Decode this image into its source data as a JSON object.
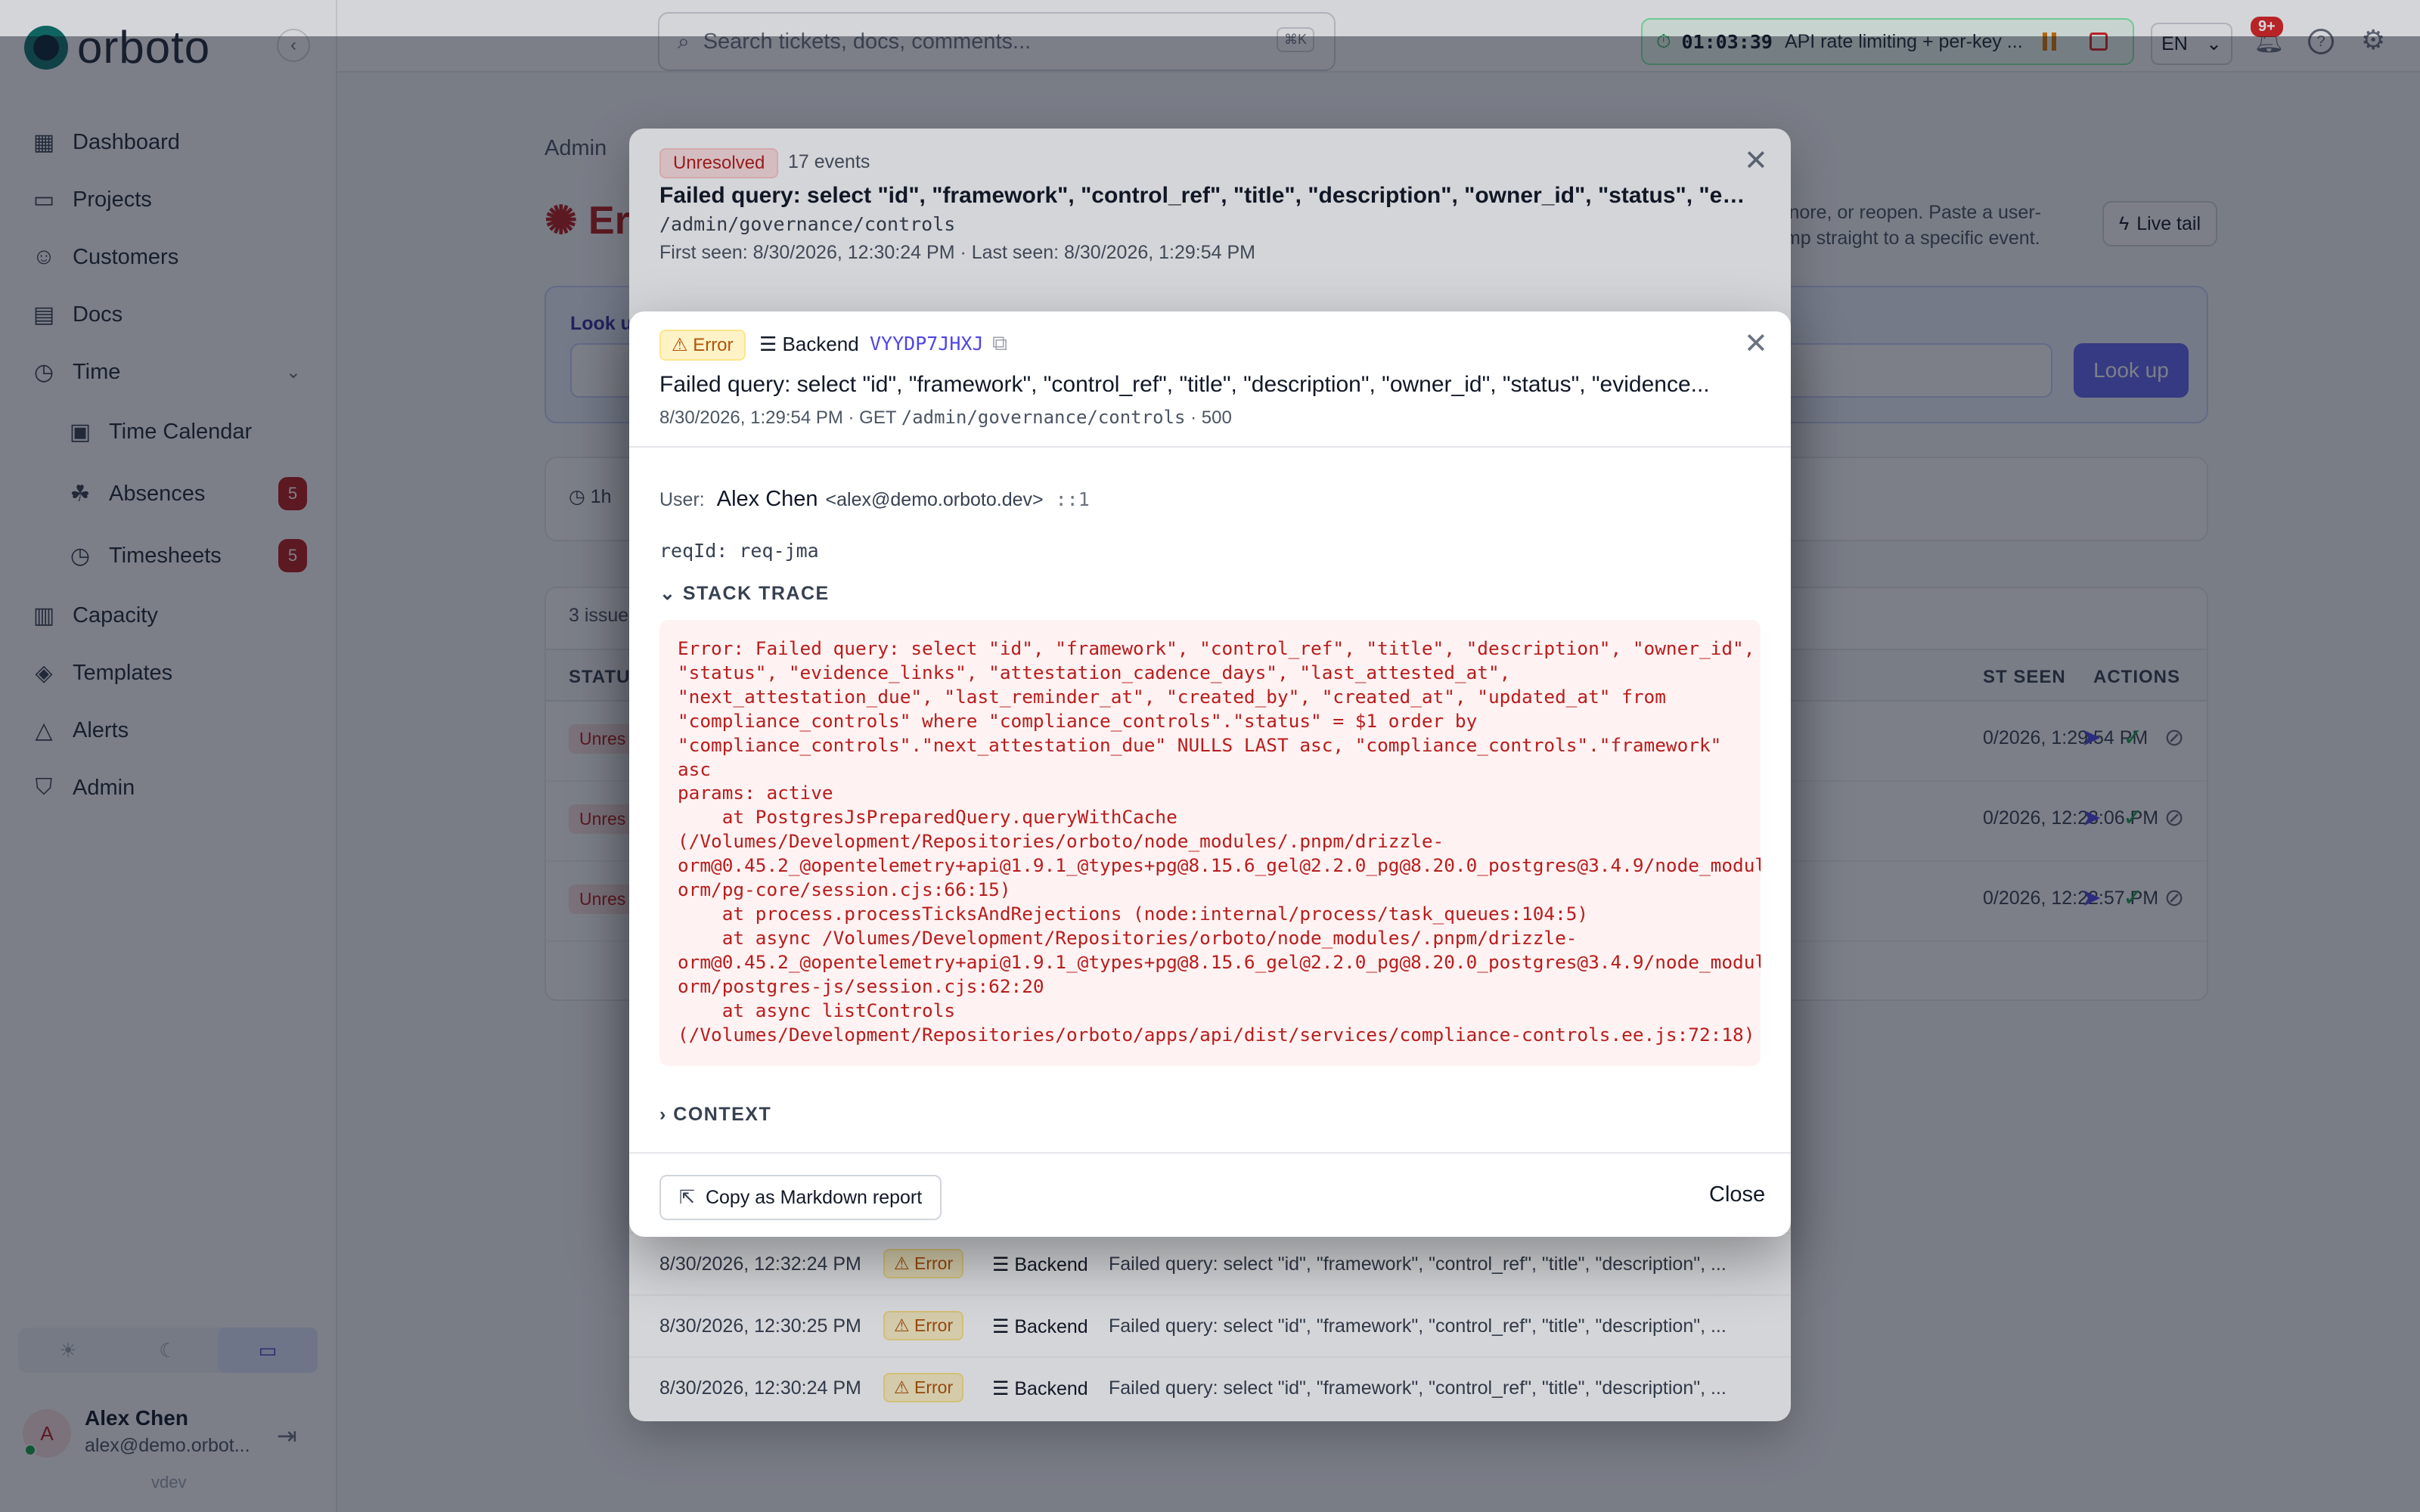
{
  "app": {
    "logo": "orboto",
    "version": "vdev"
  },
  "sidebar": {
    "items": [
      {
        "label": "Dashboard",
        "icon": "dashboard-icon"
      },
      {
        "label": "Projects",
        "icon": "folder-icon"
      },
      {
        "label": "Customers",
        "icon": "users-icon"
      },
      {
        "label": "Docs",
        "icon": "book-icon"
      },
      {
        "label": "Time",
        "icon": "clock-icon"
      },
      {
        "label": "Time Calendar",
        "icon": "calendar-icon"
      },
      {
        "label": "Absences",
        "icon": "palm-icon",
        "badge": "5"
      },
      {
        "label": "Timesheets",
        "icon": "clock-icon",
        "badge": "5"
      },
      {
        "label": "Capacity",
        "icon": "bar-chart-icon"
      },
      {
        "label": "Templates",
        "icon": "layers-icon"
      },
      {
        "label": "Alerts",
        "icon": "alert-icon"
      },
      {
        "label": "Admin",
        "icon": "shield-icon"
      }
    ],
    "user": {
      "initial": "A",
      "name": "Alex Chen",
      "email": "alex@demo.orbot..."
    }
  },
  "topbar": {
    "search_placeholder": "Search tickets, docs, comments...",
    "search_shortcut": "⌘K",
    "timer": {
      "time": "01:03:39",
      "description": "API rate limiting + per-key ..."
    },
    "language": "EN",
    "notifications": "9+"
  },
  "page": {
    "breadcrumb": "Admin",
    "title_partial": "Er",
    "intro_partial": "ignore, or reopen. Paste a user-\nump straight to a specific event.",
    "live_tail_label": "Live tail",
    "lookup_label": "Look u",
    "lookup_button": "Look up",
    "range": "1h",
    "issues_count": "3 issue",
    "columns": {
      "status": "STATU",
      "last_seen": "ST SEEN",
      "actions": "ACTIONS"
    },
    "issues": [
      {
        "status": "Unres",
        "last_seen": "0/2026, 1:29:54 PM"
      },
      {
        "status": "Unres",
        "last_seen": "0/2026, 12:23:06 PM"
      },
      {
        "status": "Unres",
        "last_seen": "0/2026, 12:22:57 PM"
      }
    ]
  },
  "issue_dialog": {
    "status": "Unresolved",
    "events": "17 events",
    "title": "Failed query: select \"id\", \"framework\", \"control_ref\", \"title\", \"description\", \"owner_id\", \"status\", \"evi...",
    "route": "/admin/governance/controls",
    "seen": "First seen: 8/30/2026, 12:30:24 PM · Last seen: 8/30/2026, 1:29:54 PM",
    "event_rows": [
      {
        "date": "8/30/2026, 12:32:24 PM",
        "level": "Error",
        "source": "Backend",
        "message": "Failed query: select \"id\", \"framework\", \"control_ref\", \"title\", \"description\", ..."
      },
      {
        "date": "8/30/2026, 12:30:25 PM",
        "level": "Error",
        "source": "Backend",
        "message": "Failed query: select \"id\", \"framework\", \"control_ref\", \"title\", \"description\", ..."
      },
      {
        "date": "8/30/2026, 12:30:24 PM",
        "level": "Error",
        "source": "Backend",
        "message": "Failed query: select \"id\", \"framework\", \"control_ref\", \"title\", \"description\", ..."
      }
    ]
  },
  "event_modal": {
    "level": "Error",
    "source": "Backend",
    "event_id": "VYYDP7JHXJ",
    "title": "Failed query: select \"id\", \"framework\", \"control_ref\", \"title\", \"description\", \"owner_id\", \"status\", \"evidence...",
    "meta_prefix": "8/30/2026, 1:29:54 PM · GET ",
    "meta_path": "/admin/governance/controls",
    "meta_suffix": " · 500",
    "user_label": "User:",
    "user_name": "Alex Chen",
    "user_email": "<alex@demo.orboto.dev>",
    "user_ip": "::1",
    "req_id": "reqId: req-jma",
    "stack_label": "STACK TRACE",
    "stack_trace": "Error: Failed query: select \"id\", \"framework\", \"control_ref\", \"title\", \"description\", \"owner_id\",\n\"status\", \"evidence_links\", \"attestation_cadence_days\", \"last_attested_at\",\n\"next_attestation_due\", \"last_reminder_at\", \"created_by\", \"created_at\", \"updated_at\" from\n\"compliance_controls\" where \"compliance_controls\".\"status\" = $1 order by\n\"compliance_controls\".\"next_attestation_due\" NULLS LAST asc, \"compliance_controls\".\"framework\"\nasc\nparams: active\n    at PostgresJsPreparedQuery.queryWithCache\n(/Volumes/Development/Repositories/orboto/node_modules/.pnpm/drizzle-\norm@0.45.2_@opentelemetry+api@1.9.1_@types+pg@8.15.6_gel@2.2.0_pg@8.20.0_postgres@3.4.9/node_module\norm/pg-core/session.cjs:66:15)\n    at process.processTicksAndRejections (node:internal/process/task_queues:104:5)\n    at async /Volumes/Development/Repositories/orboto/node_modules/.pnpm/drizzle-\norm@0.45.2_@opentelemetry+api@1.9.1_@types+pg@8.15.6_gel@2.2.0_pg@8.20.0_postgres@3.4.9/node_module\norm/postgres-js/session.cjs:62:20\n    at async listControls\n(/Volumes/Development/Repositories/orboto/apps/api/dist/services/compliance-controls.ee.js:72:18)",
    "context_label": "CONTEXT",
    "copy_markdown": "Copy as Markdown report",
    "close": "Close"
  }
}
